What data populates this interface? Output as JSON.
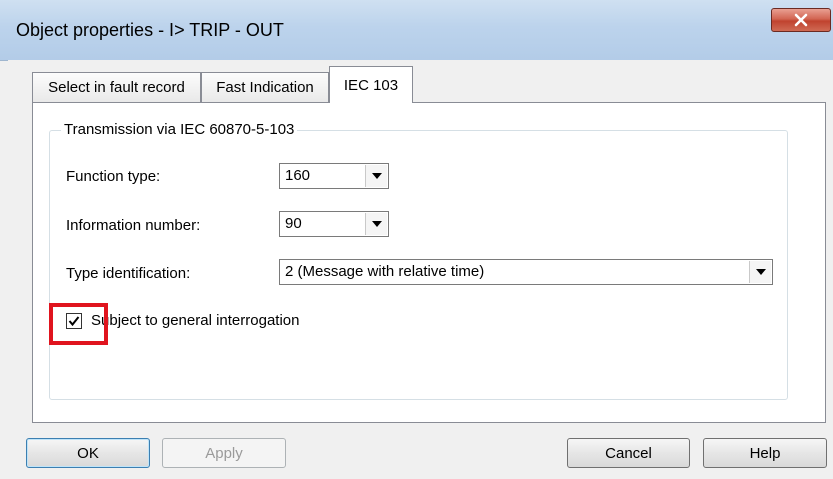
{
  "window": {
    "title": "Object properties - I> TRIP - OUT",
    "close_icon": "close-icon"
  },
  "tabs": [
    {
      "label": "Select in fault record",
      "active": false
    },
    {
      "label": "Fast Indication",
      "active": false
    },
    {
      "label": "IEC 103",
      "active": true
    }
  ],
  "group": {
    "title": "Transmission via IEC 60870-5-103"
  },
  "fields": {
    "function_type": {
      "label": "Function type:",
      "value": "160"
    },
    "information_number": {
      "label": "Information number:",
      "value": "90"
    },
    "type_identification": {
      "label": "Type identification:",
      "value": "2 (Message with relative time)"
    }
  },
  "general_interrogation": {
    "label": "Subject to general interrogation",
    "checked": true
  },
  "highlight_color": "#e0141e",
  "buttons": {
    "ok": "OK",
    "apply": "Apply",
    "cancel": "Cancel",
    "help": "Help"
  }
}
